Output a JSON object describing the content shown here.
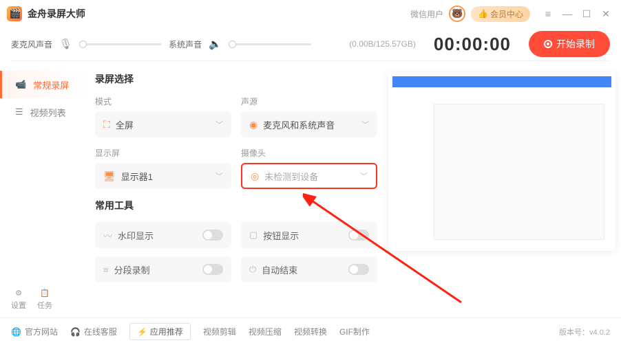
{
  "app": {
    "title": "金舟录屏大师"
  },
  "titlebar": {
    "wxUser": "微信用户",
    "vipLabel": "会员中心"
  },
  "toolbar": {
    "micLabel": "麦克风声音",
    "sysLabel": "系统声音",
    "storage": "(0.00B/125.57GB)",
    "timer": "00:00:00",
    "recordLabel": "开始录制"
  },
  "sidebar": {
    "tab1": "常规录屏",
    "tab2": "视频列表",
    "settings": "设置",
    "tasks": "任务"
  },
  "config": {
    "section1": "录屏选择",
    "modeLabel": "模式",
    "modeValue": "全屏",
    "audioLabel": "声源",
    "audioValue": "麦克风和系统声音",
    "displayLabel": "显示屏",
    "displayValue": "显示器1",
    "cameraLabel": "摄像头",
    "cameraValue": "未检测到设备",
    "section2": "常用工具",
    "watermark": "水印显示",
    "buttonShow": "按钮显示",
    "segment": "分段录制",
    "autoEnd": "自动结束"
  },
  "footer": {
    "website": "官方网站",
    "support": "在线客服",
    "appRec": "应用推荐",
    "vEdit": "视频剪辑",
    "vCompress": "视频压缩",
    "vConvert": "视频转换",
    "gif": "GIF制作",
    "version": "版本号：v4.0.2"
  }
}
